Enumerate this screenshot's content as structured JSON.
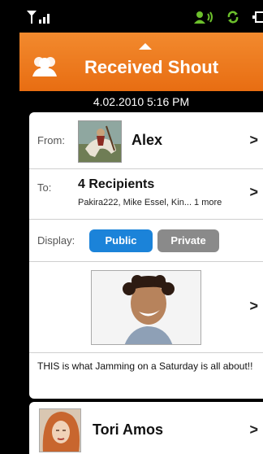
{
  "header": {
    "title": "Received Shout"
  },
  "shout": {
    "datetime": "4.02.2010 5:16 PM",
    "from_label": "From:",
    "from_name": "Alex",
    "to_label": "To:",
    "to_title": "4 Recipients",
    "to_list": "Pakira222, Mike Essel, Kin... 1 more",
    "display_label": "Display:",
    "display_options": [
      "Public",
      "Private"
    ],
    "display_selected": "Public",
    "message": "THIS is what Jamming on a Saturday is all about!!"
  },
  "next_item": {
    "name": "Tori Amos"
  },
  "colors": {
    "header_orange": "#ee7b1f",
    "public_blue": "#1b83d9",
    "private_gray": "#8a8a8a"
  }
}
